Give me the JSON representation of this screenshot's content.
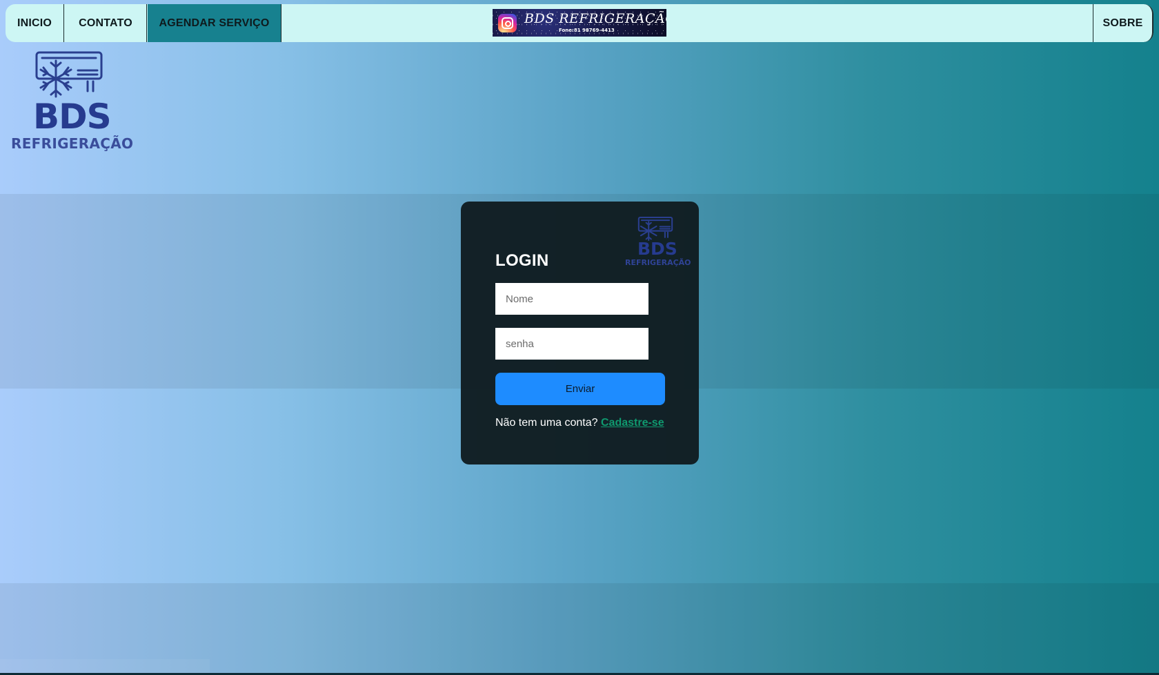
{
  "nav": {
    "items": [
      {
        "label": "INICIO"
      },
      {
        "label": "CONTATO"
      },
      {
        "label": "AGENDAR SERVIÇO",
        "active": true
      },
      {
        "label": "SOBRE"
      }
    ],
    "banner": {
      "title": "BDS REFRIGERAÇÃO",
      "phone": "Fone:81 98769-4413",
      "icon": "instagram-icon"
    }
  },
  "brand": {
    "name": "BDS",
    "subtitle": "REFRIGERAÇÃO",
    "icon": "air-conditioner-snowflake-icon",
    "color": "#263b8f"
  },
  "login": {
    "title": "LOGIN",
    "name_placeholder": "Nome",
    "password_placeholder": "senha",
    "submit_label": "Enviar",
    "signup_prompt": "Não tem uma conta?",
    "signup_link": "Cadastre-se"
  },
  "colors": {
    "nav_bg": "#cdf6f4",
    "nav_active": "#17818f",
    "card_bg": "#101c20",
    "button": "#1e8cff",
    "link": "#0f9a6f"
  }
}
